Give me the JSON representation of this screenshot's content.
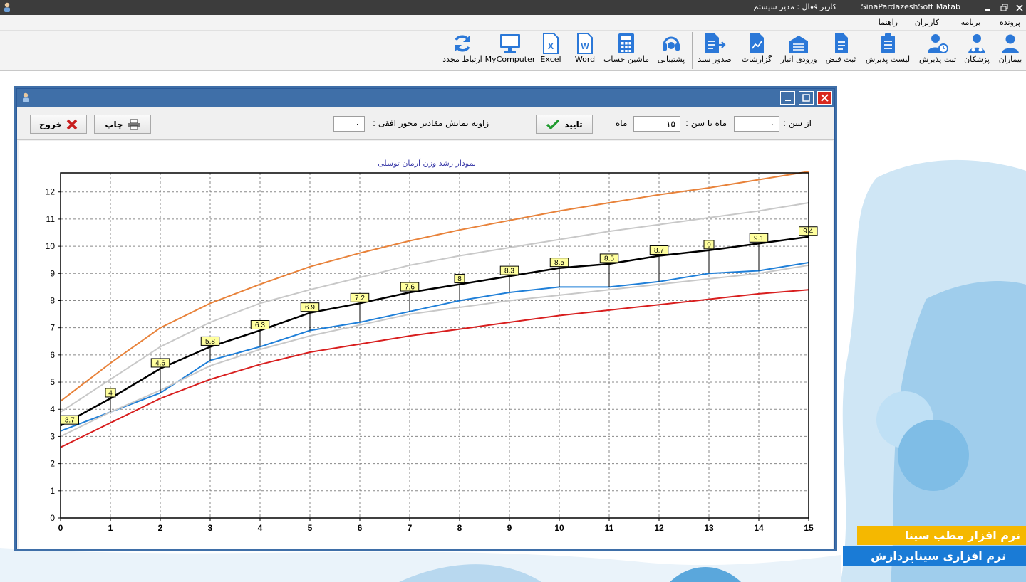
{
  "app": {
    "title": "SinaPardazeshSoft Matab",
    "active_user": "کاربر فعال : مدیر سیستم"
  },
  "menu": [
    "پرونده",
    "برنامه",
    "کاربران",
    "راهنما"
  ],
  "toolbar": [
    {
      "label": "بیماران",
      "icon": "patient-icon"
    },
    {
      "label": "پزشکان",
      "icon": "doctors-icon"
    },
    {
      "label": "ثبت پذیرش",
      "icon": "register-admission-icon"
    },
    {
      "label": "لیست پذیرش",
      "icon": "admission-list-icon"
    },
    {
      "label": "ثبت قبض",
      "icon": "receipt-icon"
    },
    {
      "label": "ورودی انبار",
      "icon": "warehouse-icon"
    },
    {
      "label": "گزارشات",
      "icon": "reports-icon"
    },
    {
      "label": "صدور سند",
      "icon": "issue-document-icon"
    },
    {
      "label": "پشتیبانی",
      "icon": "support-headset-icon"
    },
    {
      "label": "ماشین حساب",
      "icon": "calculator-icon"
    },
    {
      "label": "Word",
      "icon": "word-icon"
    },
    {
      "label": "Excel",
      "icon": "excel-icon"
    },
    {
      "label": "MyComputer",
      "icon": "computer-monitor-icon"
    },
    {
      "label": "ارتباط مجدد",
      "icon": "reconnect-icon"
    }
  ],
  "dialog": {
    "from_age_label": "از سن :",
    "from_age_value": "۰",
    "to_age_label": "ماه تا سن :",
    "to_age_value": "۱۵",
    "month_label": "ماه",
    "confirm_label": "تایید",
    "angle_label": "زاویه نمایش مقادیر محور افقی :",
    "angle_value": "۰",
    "print_label": "چاپ",
    "exit_label": "خروج"
  },
  "chart_data": {
    "type": "line",
    "title": "نمودار رشد وزن آرمان توسلی",
    "x": [
      0,
      1,
      2,
      3,
      4,
      5,
      6,
      7,
      8,
      9,
      10,
      11,
      12,
      13,
      14,
      15
    ],
    "xlim": [
      0,
      15
    ],
    "ylim": [
      0,
      12.7
    ],
    "yticks": [
      0,
      1,
      2,
      3,
      4,
      5,
      6,
      7,
      8,
      9,
      10,
      11,
      12
    ],
    "grid": true,
    "series": [
      {
        "color": "#e8823a",
        "values": [
          4.3,
          5.7,
          7.0,
          7.9,
          8.6,
          9.25,
          9.75,
          10.2,
          10.6,
          10.95,
          11.3,
          11.6,
          11.9,
          12.15,
          12.45,
          12.75
        ]
      },
      {
        "color": "#c8c8c8",
        "values": [
          3.9,
          5.1,
          6.3,
          7.2,
          7.9,
          8.4,
          8.85,
          9.3,
          9.65,
          9.95,
          10.25,
          10.55,
          10.8,
          11.05,
          11.3,
          11.6
        ]
      },
      {
        "color": "#000000",
        "width": 2.5,
        "values": [
          3.4,
          4.4,
          5.5,
          6.3,
          6.9,
          7.55,
          7.9,
          8.3,
          8.6,
          8.9,
          9.2,
          9.35,
          9.65,
          9.85,
          10.1,
          10.35
        ]
      },
      {
        "color": "#1f7fd8",
        "values": [
          3.2,
          3.9,
          4.6,
          5.8,
          6.3,
          6.9,
          7.2,
          7.6,
          8.0,
          8.3,
          8.5,
          8.5,
          8.7,
          9.0,
          9.1,
          9.4
        ]
      },
      {
        "color": "#c8c8c8",
        "values": [
          3.0,
          3.9,
          4.7,
          5.6,
          6.2,
          6.7,
          7.1,
          7.5,
          7.75,
          8.0,
          8.2,
          8.4,
          8.6,
          8.8,
          9.0,
          9.3
        ]
      },
      {
        "color": "#d81e1e",
        "values": [
          2.6,
          3.5,
          4.4,
          5.1,
          5.65,
          6.1,
          6.4,
          6.7,
          6.95,
          7.2,
          7.45,
          7.65,
          7.85,
          8.05,
          8.25,
          8.4
        ]
      }
    ],
    "data_labels": {
      "x": [
        0,
        1,
        2,
        3,
        4,
        5,
        6,
        7,
        8,
        9,
        10,
        11,
        12,
        13,
        14,
        15
      ],
      "text": [
        "3.7",
        "4",
        "4.6",
        "5.8",
        "6.3",
        "6.9",
        "7.2",
        "7.6",
        "8",
        "8.3",
        "8.5",
        "8.5",
        "8.7",
        "9",
        "9.1",
        "9.4"
      ],
      "anchor_values": [
        3.4,
        4.4,
        5.5,
        6.3,
        6.9,
        7.55,
        7.9,
        8.3,
        8.6,
        8.9,
        9.2,
        9.35,
        9.65,
        9.85,
        10.1,
        10.35
      ]
    }
  },
  "brand": {
    "line1": "نرم افزار مطب سینا",
    "line2": "نرم افزاری سیناپردازش"
  },
  "colors": {
    "titlebar": "#3c3c3c",
    "dialog_title": "#3f6fa8",
    "toolbar_icon": "#2b78d8",
    "brand_yellow": "#f5b800",
    "brand_blue": "#1a7bd6"
  }
}
